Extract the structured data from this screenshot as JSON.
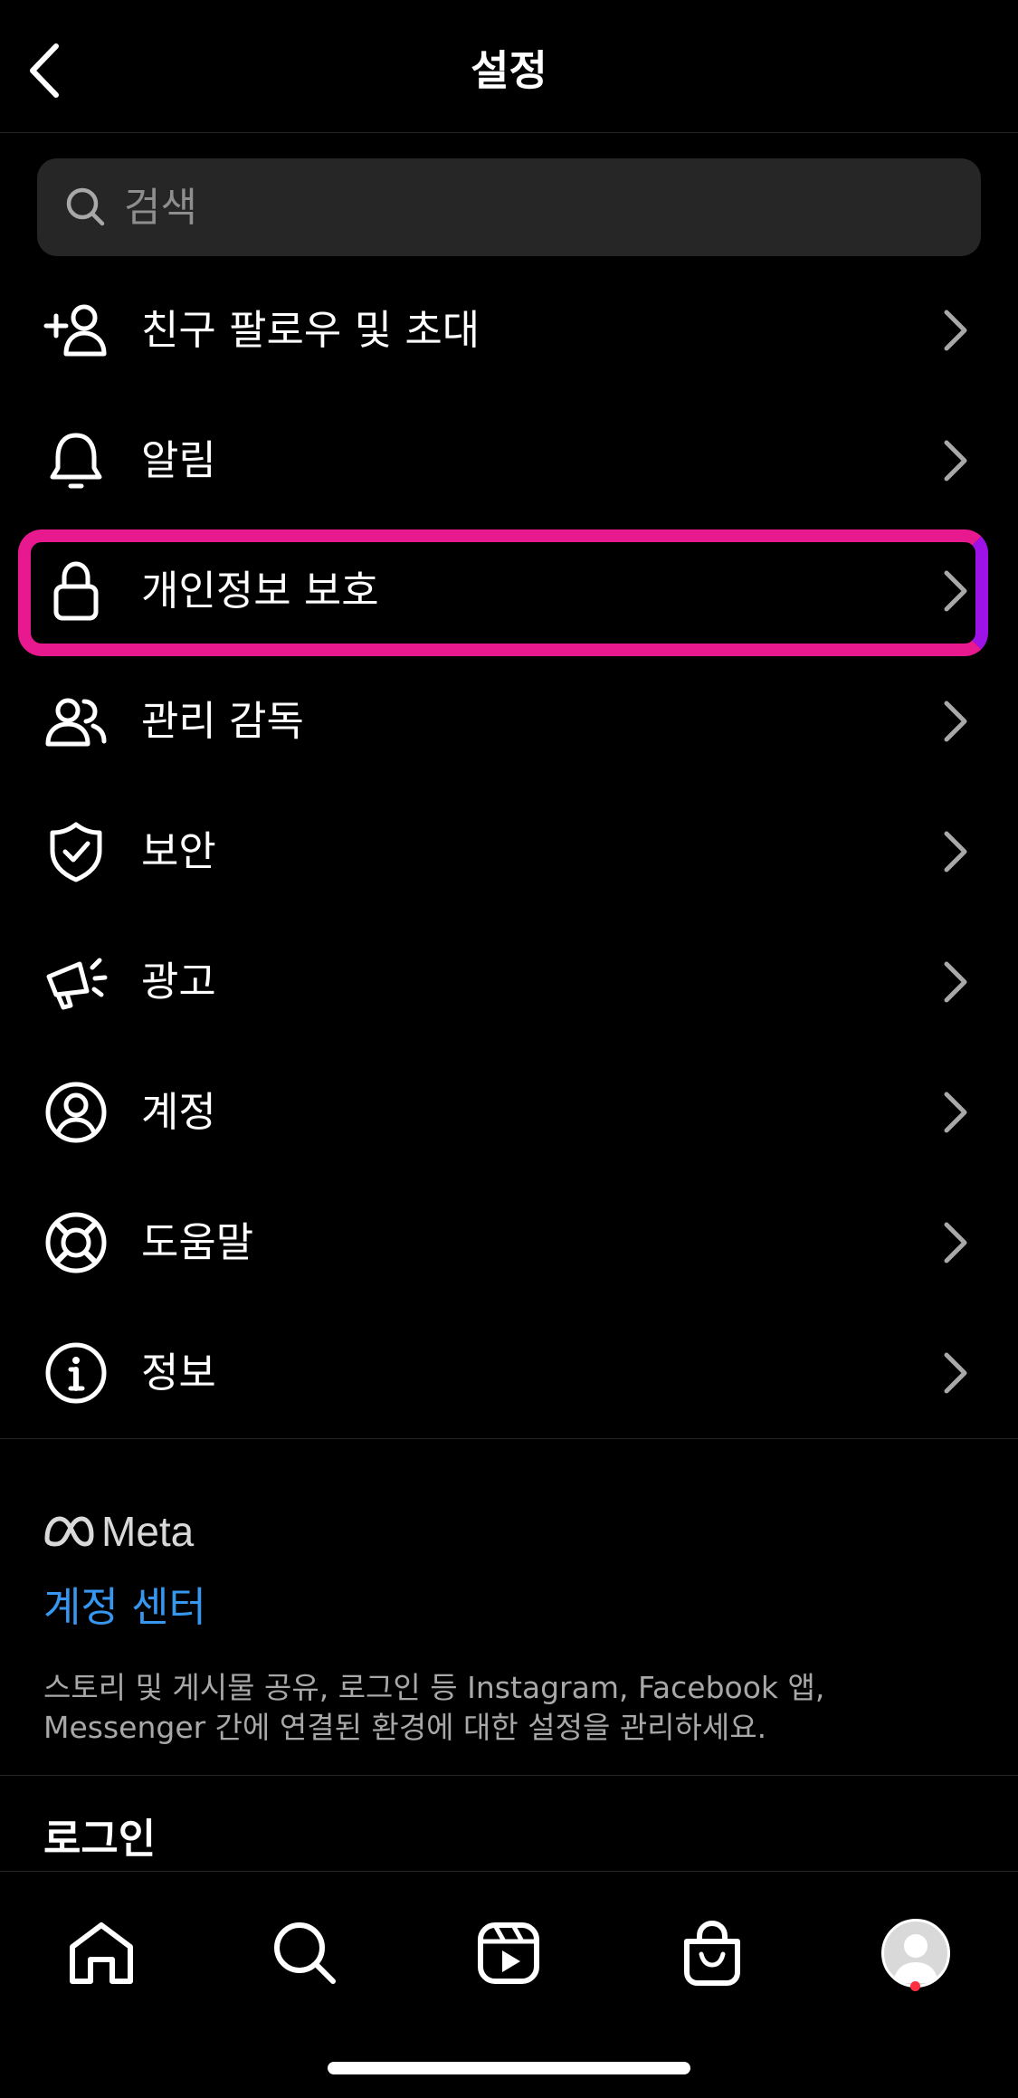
{
  "header": {
    "title": "설정"
  },
  "search": {
    "placeholder": "검색"
  },
  "menu": {
    "items": [
      {
        "label": "친구 팔로우 및 초대",
        "icon": "add-person-icon"
      },
      {
        "label": "알림",
        "icon": "bell-icon"
      },
      {
        "label": "개인정보 보호",
        "icon": "lock-icon"
      },
      {
        "label": "관리 감독",
        "icon": "people-icon"
      },
      {
        "label": "보안",
        "icon": "shield-check-icon"
      },
      {
        "label": "광고",
        "icon": "megaphone-icon"
      },
      {
        "label": "계정",
        "icon": "account-circle-icon"
      },
      {
        "label": "도움말",
        "icon": "lifebuoy-icon"
      },
      {
        "label": "정보",
        "icon": "info-icon"
      }
    ],
    "highlighted_index": 2
  },
  "meta": {
    "logo_text": "Meta",
    "accounts_center": "계정 센터",
    "description": "스토리 및 게시물 공유, 로그인 등 Instagram, Facebook 앱, Messenger 간에 연결된 환경에 대한 설정을 관리하세요."
  },
  "login": {
    "heading": "로그인"
  },
  "colors": {
    "background": "#000000",
    "text": "#ffffff",
    "secondary_text": "#a8a8a8",
    "accent_link": "#3797f0",
    "highlight_border": "#e8188f",
    "notification_dot": "#ff3040"
  },
  "bottom_nav": {
    "items": [
      "home-icon",
      "search-icon",
      "reels-icon",
      "shop-icon",
      "profile-avatar"
    ]
  }
}
